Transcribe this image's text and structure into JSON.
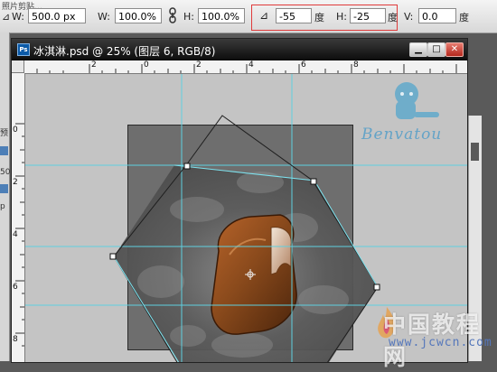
{
  "options_bar": {
    "top_left_text": "照片剪贴…",
    "w_label": "W:",
    "w_value": "500.0 px",
    "w_pct_label": "W:",
    "w_pct_value": "100.0%",
    "h_label": "H:",
    "h_value": "100.0%",
    "angle_value": "-55",
    "angle_unit": "度",
    "skew_h_label": "H:",
    "skew_h_value": "-25",
    "skew_h_unit": "度",
    "skew_v_label": "V:",
    "skew_v_value": "0.0",
    "skew_v_unit": "度",
    "highlight_color": "#e03b3b"
  },
  "left_panel": {
    "labels": [
      "预",
      "50",
      "p"
    ]
  },
  "document": {
    "title": "冰淇淋.psd @ 25% (图层 6, RGB/8)",
    "icon_text": "Ps",
    "window_buttons": [
      "minimize",
      "maximize",
      "close"
    ]
  },
  "rulers": {
    "horizontal": [
      "2",
      "0",
      "2",
      "4",
      "6",
      "8"
    ],
    "vertical": [
      "0",
      "2",
      "4",
      "6",
      "8"
    ]
  },
  "watermarks": {
    "signature": "Benvatou",
    "site_name": "中国教程网",
    "site_url": "www.jcwcn.com"
  },
  "colors": {
    "guide": "#5fd0e0",
    "transform_box": "#222222",
    "canvas_bg": "#6e6e6e"
  }
}
